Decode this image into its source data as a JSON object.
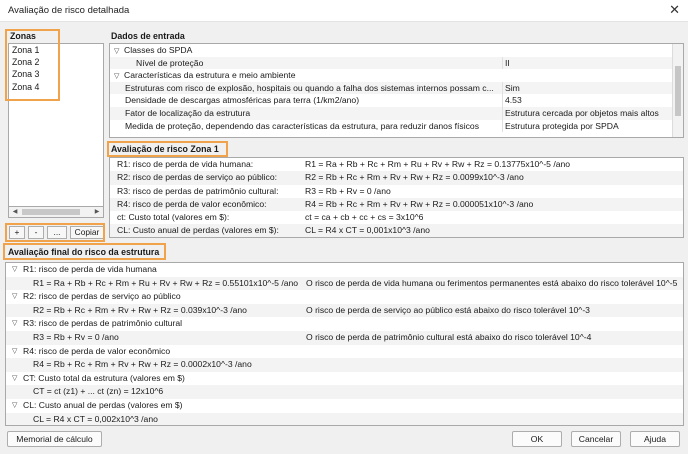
{
  "window": {
    "title": "Avaliação de risco detalhada",
    "close_glyph": "✕"
  },
  "zones": {
    "label": "Zonas",
    "items": [
      "Zona 1",
      "Zona 2",
      "Zona 3",
      "Zona 4"
    ],
    "buttons": {
      "add": "+",
      "remove": "-",
      "more": "...",
      "copy": "Copiar"
    }
  },
  "input_data": {
    "label": "Dados de entrada",
    "rows": [
      {
        "type": "category",
        "label": "Classes do SPDA"
      },
      {
        "type": "prop",
        "key": "Nível de proteção",
        "value": "II"
      },
      {
        "type": "category",
        "label": "Características da estrutura e meio ambiente"
      },
      {
        "type": "prop",
        "key": "Estruturas com risco de explosão, hospitais ou quando a falha dos sistemas internos possam c...",
        "value": "Sim"
      },
      {
        "type": "prop",
        "key": "Densidade de descargas atmosféricas para terra (1/km2/ano)",
        "value": "4.53"
      },
      {
        "type": "prop",
        "key": "Fator de localização da estrutura",
        "value": "Estrutura cercada por objetos mais altos"
      },
      {
        "type": "prop",
        "key": "Medida de proteção, dependendo das características da estrutura, para reduzir danos físicos",
        "value": "Estrutura protegida por SPDA"
      }
    ]
  },
  "zone_risk": {
    "label": "Avaliação de risco Zona 1",
    "rows": [
      {
        "key": "R1: risco de perda de vida humana:",
        "value": "R1 = Ra + Rb + Rc + Rm + Ru + Rv + Rw + Rz = 0.13775x10^-5 /ano"
      },
      {
        "key": "R2: risco de perdas de serviço ao público:",
        "value": "R2 = Rb + Rc + Rm + Rv + Rw + Rz = 0.0099x10^-3 /ano"
      },
      {
        "key": "R3: risco de perdas de patrimônio cultural:",
        "value": "R3 = Rb + Rv = 0 /ano"
      },
      {
        "key": "R4: risco de perda de valor econômico:",
        "value": "R4 = Rb + Rc + Rm + Rv + Rw + Rz = 0.000051x10^-3 /ano"
      },
      {
        "key": "ct: Custo total (valores em $):",
        "value": "ct = ca + cb + cc + cs = 3x10^6"
      },
      {
        "key": "CL: Custo anual de perdas (valores em $):",
        "value": "CL = R4 x CT = 0,001x10^3 /ano"
      }
    ]
  },
  "final_eval": {
    "label": "Avaliação final do risco da estrutura",
    "groups": [
      {
        "header": "R1: risco de perda de vida humana",
        "value": "R1 = Ra + Rb + Rc + Rm + Ru + Rv + Rw + Rz = 0.55101x10^-5 /ano",
        "message": "O risco de perda de vida humana ou ferimentos permanentes está abaixo do risco tolerável 10^-5"
      },
      {
        "header": "R2: risco de perdas de serviço ao público",
        "value": "R2 = Rb + Rc + Rm + Rv + Rw + Rz = 0.039x10^-3 /ano",
        "message": "O risco de perda de serviço ao público está abaixo do risco tolerável 10^-3"
      },
      {
        "header": "R3: risco de perdas de patrimônio cultural",
        "value": "R3 = Rb + Rv = 0 /ano",
        "message": "O risco de perda de patrimônio cultural está abaixo do risco tolerável 10^-4"
      },
      {
        "header": "R4: risco de perda de valor econômico",
        "value": "R4 = Rb + Rc + Rm + Rv + Rw + Rz = 0.0002x10^-3 /ano",
        "message": ""
      },
      {
        "header": "CT: Custo total da estrutura (valores em $)",
        "value": "CT = ct (z1) + ... ct (zn) = 12x10^6",
        "message": ""
      },
      {
        "header": "CL: Custo anual de perdas (valores em $)",
        "value": "CL = R4 x CT = 0,002x10^3 /ano",
        "message": ""
      }
    ]
  },
  "footer": {
    "calc_memory": "Memorial de cálculo",
    "ok": "OK",
    "cancel": "Cancelar",
    "help": "Ajuda"
  },
  "colors": {
    "highlight_border": "#f0a34a"
  }
}
